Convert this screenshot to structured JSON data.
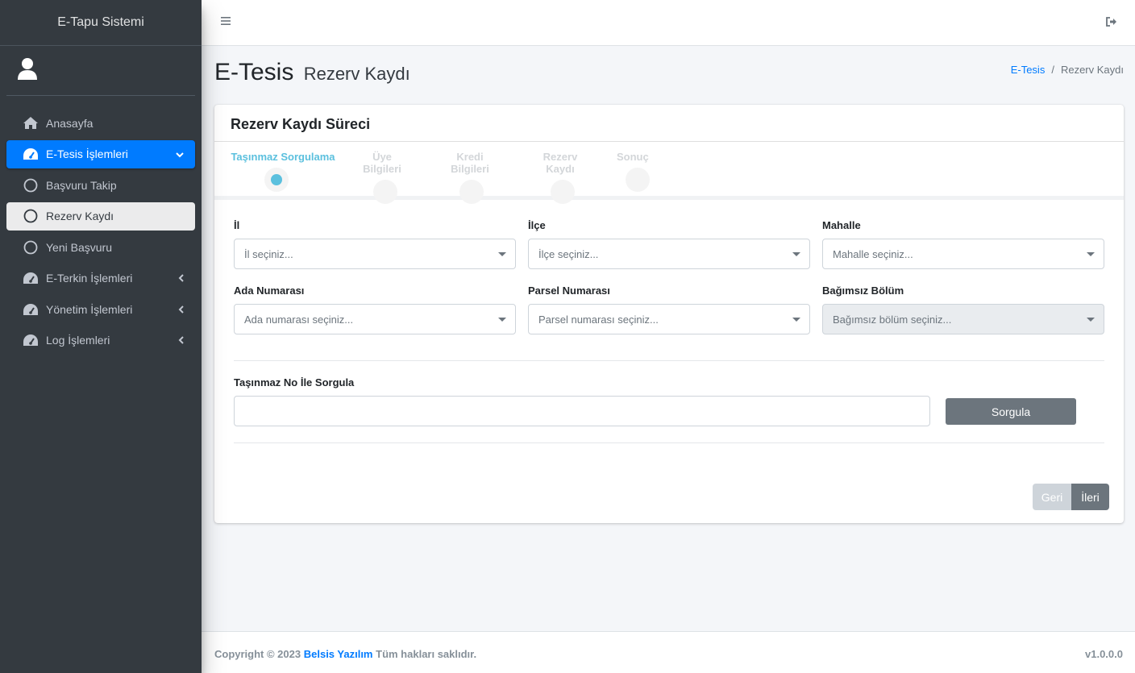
{
  "sidebar": {
    "brand": "E-Tapu Sistemi",
    "items": [
      {
        "label": "Anasayfa",
        "icon": "home-icon"
      },
      {
        "label": "E-Tesis İşlemleri",
        "icon": "dashboard-icon"
      },
      {
        "label": "Başvuru Takip",
        "icon": "circle-icon"
      },
      {
        "label": "Rezerv Kaydı",
        "icon": "circle-icon"
      },
      {
        "label": "Yeni Başvuru",
        "icon": "circle-icon"
      },
      {
        "label": "E-Terkin İşlemleri",
        "icon": "dashboard-icon"
      },
      {
        "label": "Yönetim İşlemleri",
        "icon": "dashboard-icon"
      },
      {
        "label": "Log İşlemleri",
        "icon": "dashboard-icon"
      }
    ]
  },
  "header": {
    "title": "E-Tesis",
    "subtitle": "Rezerv Kaydı",
    "breadcrumb": [
      "E-Tesis",
      "/",
      "Rezerv Kaydı"
    ]
  },
  "card": {
    "title": "Rezerv Kaydı Süreci",
    "steps": [
      "Taşınmaz Sorgulama",
      "Üye Bilgileri",
      "Kredi Bilgileri",
      "Rezerv Kaydı",
      "Sonuç"
    ],
    "fields": {
      "il": {
        "label": "İl",
        "placeholder": "İl seçiniz..."
      },
      "ilce": {
        "label": "İlçe",
        "placeholder": "İlçe seçiniz..."
      },
      "mahalle": {
        "label": "Mahalle",
        "placeholder": "Mahalle seçiniz..."
      },
      "ada": {
        "label": "Ada Numarası",
        "placeholder": "Ada numarası seçiniz..."
      },
      "parsel": {
        "label": "Parsel Numarası",
        "placeholder": "Parsel numarası seçiniz..."
      },
      "bagimsiz": {
        "label": "Bağımsız Bölüm",
        "placeholder": "Bağımsız bölüm seçiniz..."
      }
    },
    "query_label": "Taşınmaz No İle Sorgula",
    "query_value": "",
    "query_button": "Sorgula",
    "back_button": "Geri",
    "next_button": "İleri"
  },
  "footer": {
    "copyright": "Copyright © 2023",
    "company": "Belsis Yazılım",
    "rights": "Tüm hakları saklıdır.",
    "version": "v1.0.0.0"
  },
  "colors": {
    "sidebar_bg": "#343a40",
    "accent": "#007bff",
    "step_active": "#5bc0de",
    "button_gray": "#6c757d"
  }
}
